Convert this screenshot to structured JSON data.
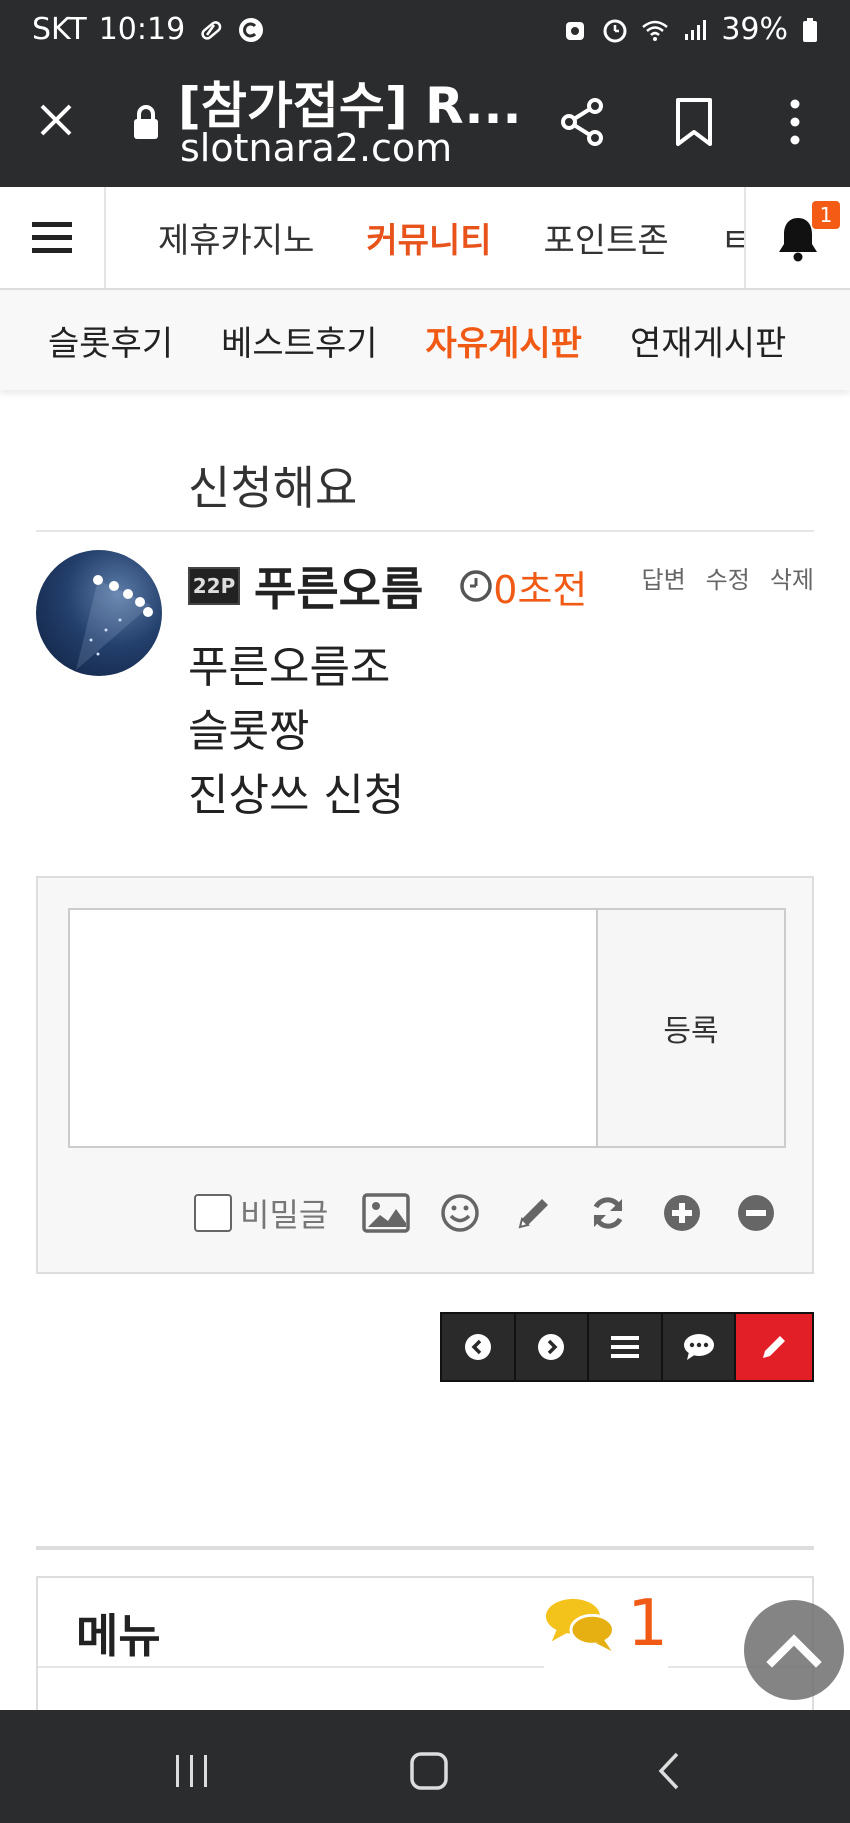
{
  "status_bar": {
    "carrier": "SKT",
    "time": "10:19",
    "battery": "39%"
  },
  "browser": {
    "page_title": "[참가접수] R...",
    "url": "slotnara2.com"
  },
  "main_nav": {
    "items": [
      {
        "label": "제휴카지노",
        "active": false
      },
      {
        "label": "커뮤니티",
        "active": true
      },
      {
        "label": "포인트존",
        "active": false
      },
      {
        "label": "ㅌ",
        "active": false
      }
    ],
    "notification_count": "1"
  },
  "sub_nav": {
    "items": [
      {
        "label": "슬롯후기",
        "active": false
      },
      {
        "label": "베스트후기",
        "active": false
      },
      {
        "label": "자유게시판",
        "active": true
      },
      {
        "label": "연재게시판",
        "active": false
      }
    ]
  },
  "post": {
    "title": "신청해요",
    "author": "푸른오름",
    "level": "22P",
    "time": "0초전",
    "actions": [
      "답변",
      "수정",
      "삭제"
    ],
    "body_lines": [
      "푸른오름조",
      "슬롯짱",
      "진상쓰 신청"
    ]
  },
  "comment_form": {
    "submit_label": "등록",
    "secret_label": "비밀글"
  },
  "bottom": {
    "menu_title": "메뉴",
    "chat_count": "1"
  },
  "colors": {
    "accent": "#f05a14",
    "dark_bar": "#2b2c2e",
    "write_button": "#e21f26"
  }
}
